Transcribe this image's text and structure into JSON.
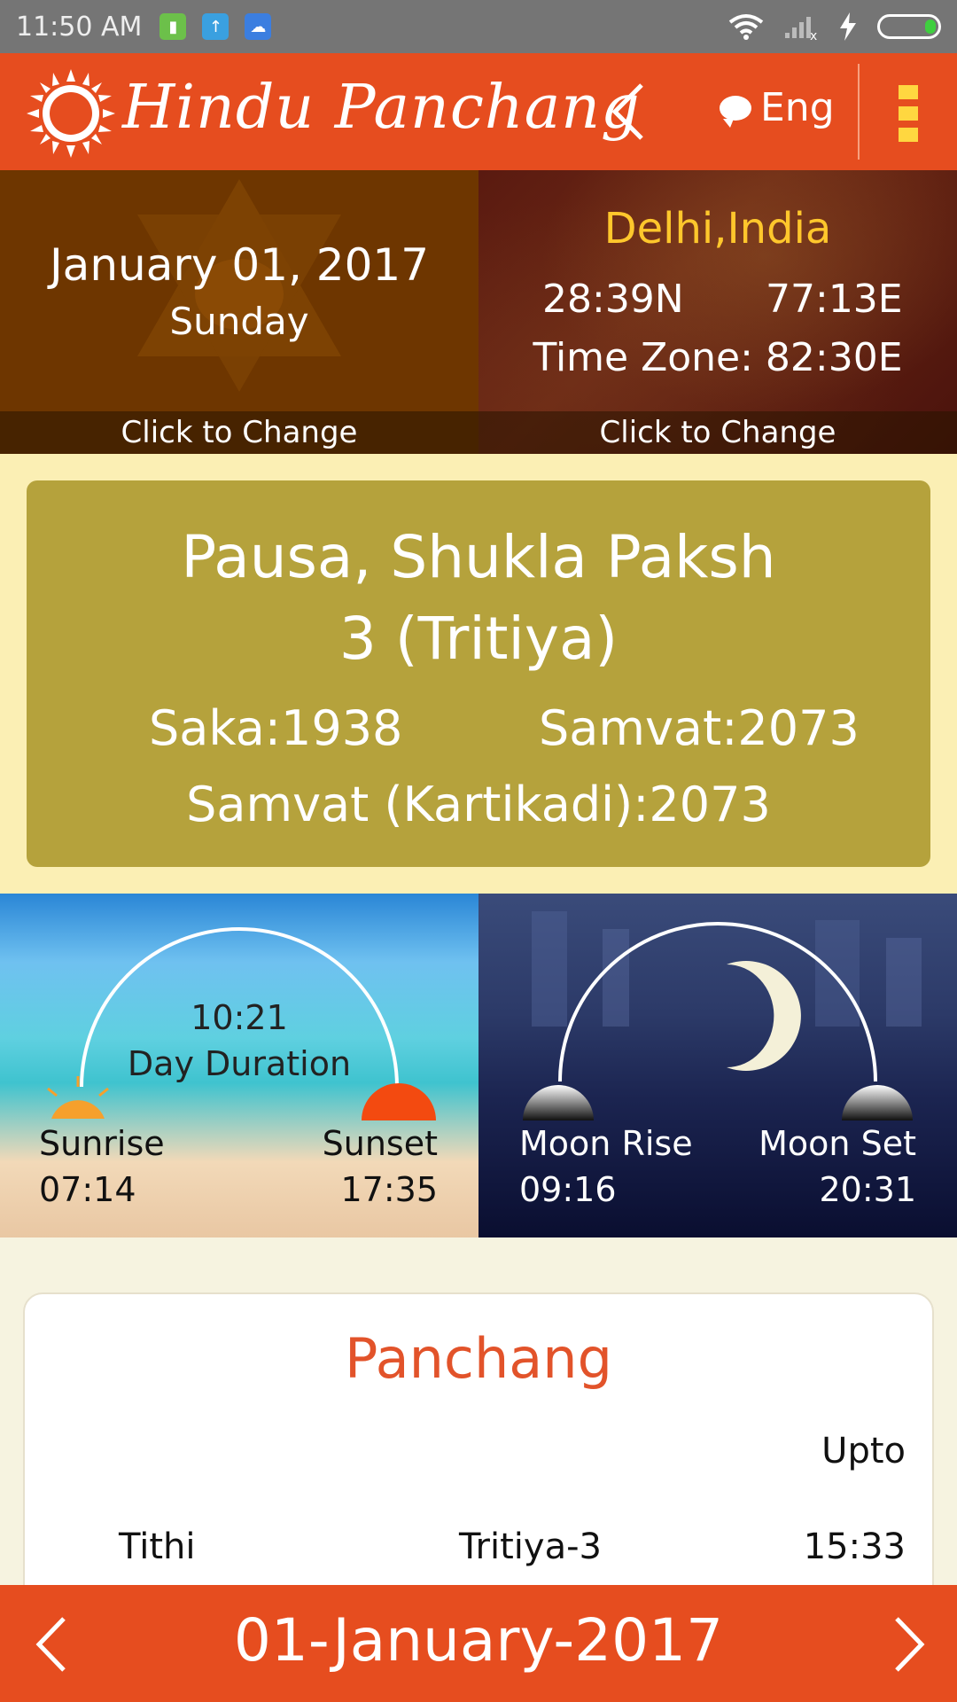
{
  "status_bar": {
    "time": "11:50 AM"
  },
  "header": {
    "title": "Hindu Panchang",
    "language": "Eng"
  },
  "date_panel": {
    "date": "January 01, 2017",
    "day": "Sunday",
    "change_label": "Click to Change"
  },
  "location_panel": {
    "city": "Delhi,India",
    "latitude": "28:39N",
    "longitude": "77:13E",
    "timezone": "Time Zone: 82:30E",
    "change_label": "Click to Change"
  },
  "month_card": {
    "line1": "Pausa, Shukla Paksh",
    "line2": "3 (Tritiya)",
    "saka": "Saka:1938",
    "samvat": "Samvat:2073",
    "samvat_kartikadi": "Samvat (Kartikadi):2073"
  },
  "sun": {
    "duration_time": "10:21",
    "duration_label": "Day Duration",
    "sunrise_label": "Sunrise",
    "sunrise_time": "07:14",
    "sunset_label": "Sunset",
    "sunset_time": "17:35"
  },
  "moon": {
    "rise_label": "Moon Rise",
    "rise_time": "09:16",
    "set_label": "Moon Set",
    "set_time": "20:31"
  },
  "panchang": {
    "title": "Panchang",
    "upto_header": "Upto",
    "rows": [
      {
        "name": "Tithi",
        "value": "Tritiya-3",
        "upto": "15:33"
      }
    ]
  },
  "bottom_nav": {
    "date": "01-January-2017"
  },
  "colors": {
    "primary": "#e64d1f",
    "accent_yellow": "#ffc72c",
    "card_olive": "#b5a23c",
    "title_orange": "#e2532a"
  }
}
